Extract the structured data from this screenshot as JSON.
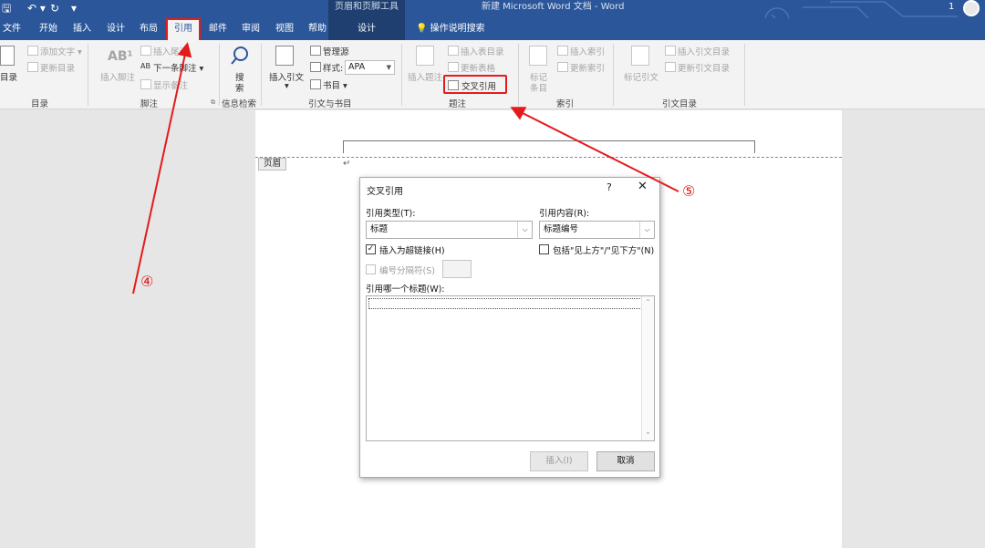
{
  "titlebar": {
    "context_tab_title": "页眉和页脚工具",
    "doc_title": "新建 Microsoft Word 文档 - Word",
    "account_number": "1"
  },
  "tabs": [
    "文件",
    "开始",
    "插入",
    "设计",
    "布局",
    "引用",
    "邮件",
    "审阅",
    "视图",
    "帮助",
    "设计"
  ],
  "tell_me": "操作说明搜索",
  "ribbon": {
    "toc": {
      "big": "目录",
      "add_text": "添加文字 ▾",
      "update_toc": "更新目录",
      "group": "目录"
    },
    "footnotes": {
      "insert_footnote": "插入脚注",
      "insert_endnote": "插入尾注",
      "next_footnote": "下一条脚注 ▾",
      "show_notes": "显示备注",
      "group": "脚注"
    },
    "research": {
      "search": "搜",
      "search2": "索",
      "group": "信息检索"
    },
    "citations": {
      "insert_citation": "插入引文",
      "manage_sources": "管理源",
      "style_label": "样式:",
      "style_value": "APA",
      "bibliography": "书目 ▾",
      "group": "引文与书目"
    },
    "captions": {
      "insert_caption": "插入题注",
      "insert_table_of_figures": "插入表目录",
      "update_table": "更新表格",
      "cross_reference": "交叉引用",
      "group": "题注"
    },
    "index": {
      "mark_entry": "标记",
      "mark_entry2": "条目",
      "insert_index": "插入索引",
      "update_index": "更新索引",
      "group": "索引"
    },
    "toa": {
      "mark_citation": "标记引文",
      "insert_toa": "插入引文目录",
      "update_toa": "更新引文目录",
      "group": "引文目录"
    }
  },
  "document": {
    "header_tag": "页眉",
    "para_mark": "↵"
  },
  "dialog": {
    "title": "交叉引用",
    "help": "?",
    "close": "✕",
    "ref_type_label": "引用类型(T):",
    "ref_type_value": "标题",
    "ref_content_label": "引用内容(R):",
    "ref_content_value": "标题编号",
    "insert_hyperlink_label": "插入为超链接(H)",
    "insert_hyperlink_checked": true,
    "include_above_below_label": "包括\"见上方\"/\"见下方\"(N)",
    "include_above_below_checked": false,
    "separator_label": "编号分隔符(S)",
    "list_label": "引用哪一个标题(W):",
    "insert_button": "插入(I)",
    "cancel_button": "取消"
  },
  "annotations": {
    "step4": "④",
    "step5": "⑤",
    "color": "#e31b1b"
  }
}
